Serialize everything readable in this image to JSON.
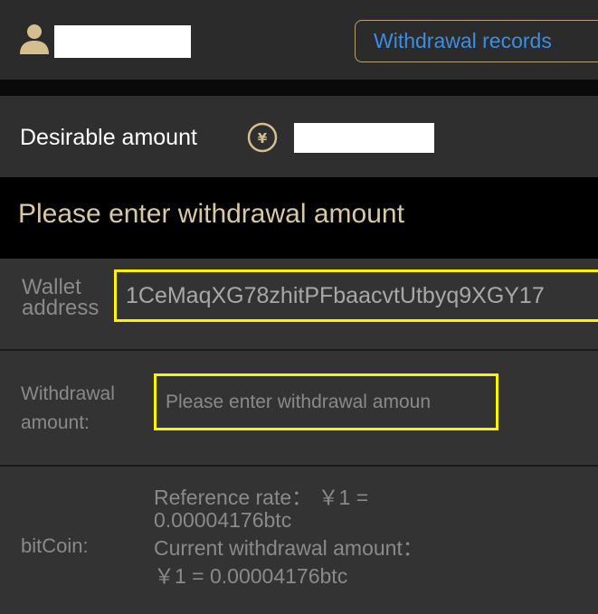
{
  "header": {
    "records_button_label": "Withdrawal records"
  },
  "balance": {
    "label": "Desirable amount"
  },
  "form": {
    "title": "Please enter withdrawal amount",
    "wallet_label_line1": "Wallet",
    "wallet_label_line2": "address",
    "wallet_value": "1CeMaqXG78zhitPFbaacvtUtbyq9XGY17",
    "amount_label_line1": "Withdrawal",
    "amount_label_line2": "amount:",
    "amount_placeholder": "Please enter withdrawal amoun",
    "currency_label": "bitCoin:",
    "rate_line1": "Reference rate： ￥1 =",
    "rate_line2": "0.00004176btc",
    "current_line1": "Current withdrawal amount：",
    "current_line2": "￥1 = 0.00004176btc"
  },
  "colors": {
    "accent_gold": "#d8c9a3",
    "link_blue": "#3a8ee6",
    "highlight_yellow": "#fff200"
  },
  "icons": {
    "user": "user-icon",
    "currency": "yuan-coin-icon"
  }
}
